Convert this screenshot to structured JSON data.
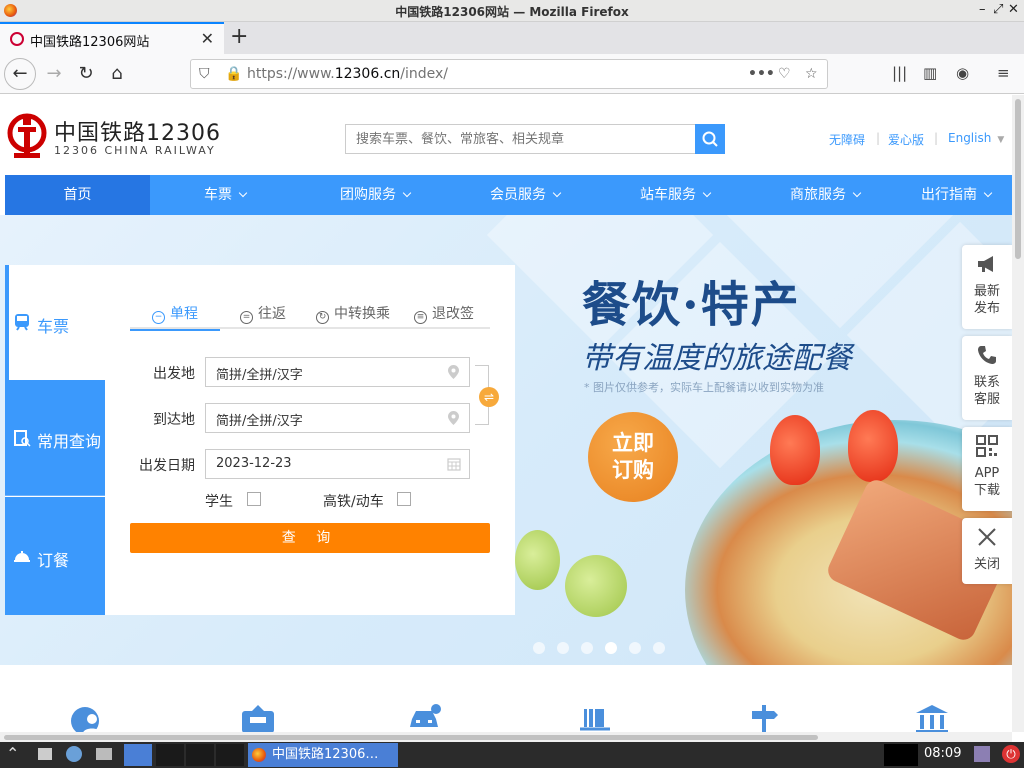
{
  "window": {
    "title": "中国铁路12306网站 — Mozilla Firefox"
  },
  "tabs": [
    {
      "label": "中国铁路12306网站"
    }
  ],
  "address": {
    "url_prefix": "https://www.",
    "url_domain": "12306.cn",
    "url_path": "/index/"
  },
  "site": {
    "logo_cn": "中国铁路12306",
    "logo_en": "12306 CHINA RAILWAY",
    "search_placeholder": "搜索车票、餐饮、常旅客、相关规章",
    "links": {
      "accessible": "无障碍",
      "care": "爱心版",
      "english": "English"
    }
  },
  "menu": [
    {
      "label": "首页"
    },
    {
      "label": "车票"
    },
    {
      "label": "团购服务"
    },
    {
      "label": "会员服务"
    },
    {
      "label": "站车服务"
    },
    {
      "label": "商旅服务"
    },
    {
      "label": "出行指南"
    }
  ],
  "booking": {
    "side_tabs": [
      {
        "label": "车票"
      },
      {
        "label": "常用查询"
      },
      {
        "label": "订餐"
      }
    ],
    "trip_tabs": [
      {
        "label": "单程"
      },
      {
        "label": "往返"
      },
      {
        "label": "中转换乘"
      },
      {
        "label": "退改签"
      }
    ],
    "from_label": "出发地",
    "from_value": "简拼/全拼/汉字",
    "to_label": "到达地",
    "to_value": "简拼/全拼/汉字",
    "date_label": "出发日期",
    "date_value": "2023-12-23",
    "student_label": "学生",
    "highspeed_label": "高铁/动车",
    "query_label": "查 询"
  },
  "banner": {
    "title": "餐饮·特产",
    "subtitle": "带有温度的旅途配餐",
    "note": "* 图片仅供参考，实际车上配餐请以收到实物为准",
    "order_line1": "立即",
    "order_line2": "订购"
  },
  "float_panel": [
    {
      "line1": "最新",
      "line2": "发布"
    },
    {
      "line1": "联系",
      "line2": "客服"
    },
    {
      "line1": "APP",
      "line2": "下载"
    },
    {
      "line1": "关闭",
      "line2": ""
    }
  ],
  "taskbar": {
    "task_label": "中国铁路12306…",
    "clock": "08:09"
  },
  "colors": {
    "brand_blue": "#3b99fc",
    "menu_active": "#2676e3",
    "query_orange": "#ff8200",
    "logo_red": "#cc0000"
  }
}
